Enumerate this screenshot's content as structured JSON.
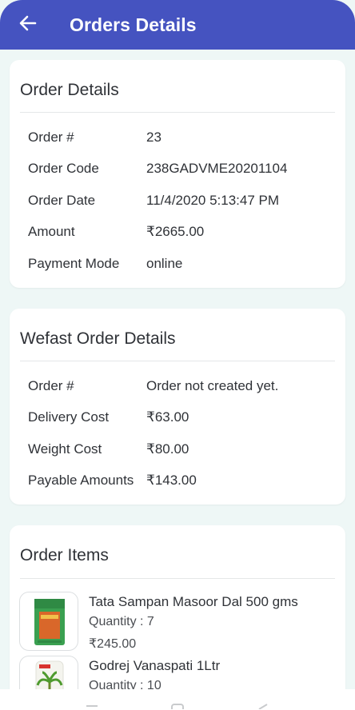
{
  "header": {
    "title": "Orders Details",
    "back_icon": "arrow-left-icon",
    "bg_color": "#4553c0"
  },
  "order_details": {
    "title": "Order Details",
    "rows": [
      {
        "label": "Order #",
        "value": "23"
      },
      {
        "label": "Order Code",
        "value": "238GADVME20201104"
      },
      {
        "label": "Order Date",
        "value": "11/4/2020 5:13:47 PM"
      },
      {
        "label": "Amount",
        "value": "₹2665.00"
      },
      {
        "label": "Payment Mode",
        "value": "online"
      }
    ]
  },
  "wefast_details": {
    "title": "Wefast Order Details",
    "rows": [
      {
        "label": "Order #",
        "value": "Order not created yet."
      },
      {
        "label": "Delivery Cost",
        "value": "₹63.00"
      },
      {
        "label": "Weight Cost",
        "value": "₹80.00"
      },
      {
        "label": "Payable Amounts",
        "value": "₹143.00"
      }
    ]
  },
  "order_items": {
    "title": "Order Items",
    "items": [
      {
        "name": "Tata Sampan Masoor Dal 500 gms",
        "quantity": "Quantity : 7",
        "price": "₹245.00"
      },
      {
        "name": "Godrej Vanaspati 1Ltr",
        "quantity": "Quantity : 10",
        "price": ""
      }
    ]
  }
}
